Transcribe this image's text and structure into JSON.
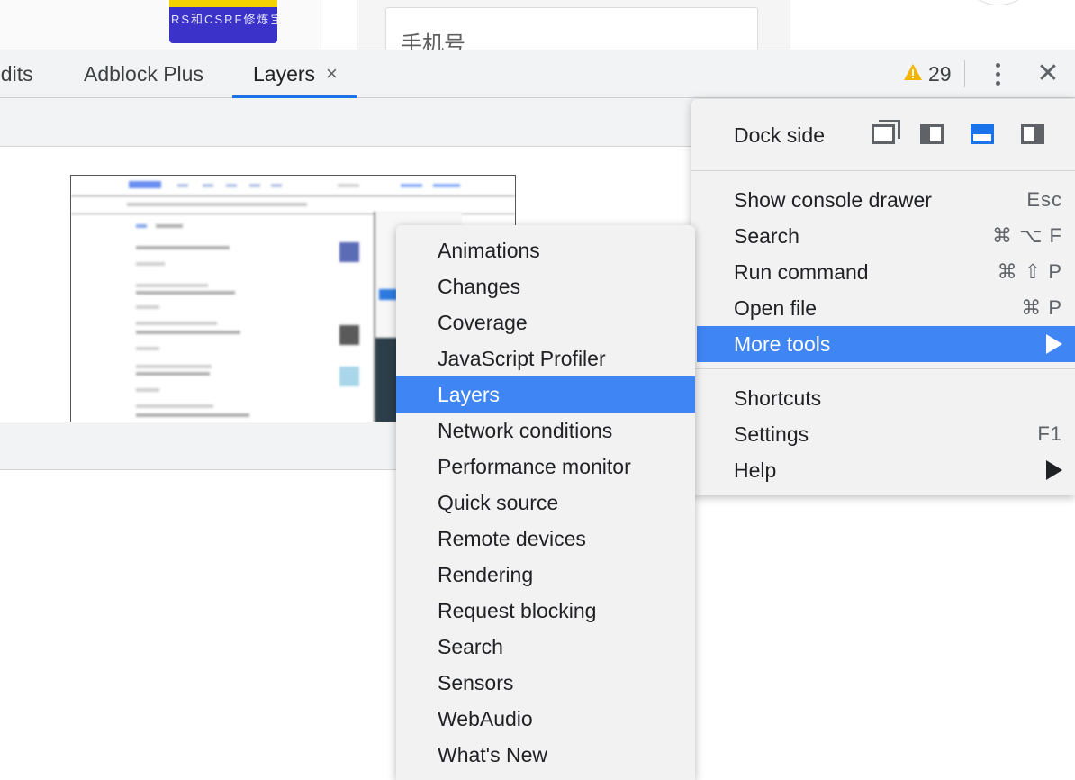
{
  "page": {
    "banner_text": "RS和CSRF修炼宝",
    "phone_placeholder": "手机号"
  },
  "tabs": [
    {
      "label": "udits"
    },
    {
      "label": "Adblock Plus"
    },
    {
      "label": "Layers",
      "close": "×",
      "active": true
    }
  ],
  "toolbar": {
    "warning_count": "29",
    "close_label": "✕"
  },
  "main_menu": {
    "dock_side_label": "Dock side",
    "dock_options": [
      "undock-into-separate-window",
      "dock-to-left",
      "dock-to-bottom",
      "dock-to-right"
    ],
    "dock_selected": "dock-to-bottom",
    "items": [
      {
        "label": "Show console drawer",
        "shortcut": "Esc"
      },
      {
        "label": "Search",
        "shortcut": "⌘ ⌥ F"
      },
      {
        "label": "Run command",
        "shortcut": "⌘ ⇧ P"
      },
      {
        "label": "Open file",
        "shortcut": "⌘ P"
      },
      {
        "label": "More tools",
        "submenu": true,
        "active": true
      },
      {
        "label": "Shortcuts"
      },
      {
        "label": "Settings",
        "shortcut": "F1"
      },
      {
        "label": "Help",
        "submenu": true
      }
    ]
  },
  "more_tools": {
    "items": [
      {
        "label": "Animations"
      },
      {
        "label": "Changes"
      },
      {
        "label": "Coverage"
      },
      {
        "label": "JavaScript Profiler"
      },
      {
        "label": "Layers",
        "active": true
      },
      {
        "label": "Network conditions"
      },
      {
        "label": "Performance monitor"
      },
      {
        "label": "Quick source"
      },
      {
        "label": "Remote devices"
      },
      {
        "label": "Rendering"
      },
      {
        "label": "Request blocking"
      },
      {
        "label": "Search"
      },
      {
        "label": "Sensors"
      },
      {
        "label": "WebAudio"
      },
      {
        "label": "What's New"
      }
    ]
  },
  "colors": {
    "accent": "#3f85f4",
    "tab_underline": "#1a73e8",
    "warning": "#f4b400",
    "menu_bg": "#f2f2f2"
  }
}
